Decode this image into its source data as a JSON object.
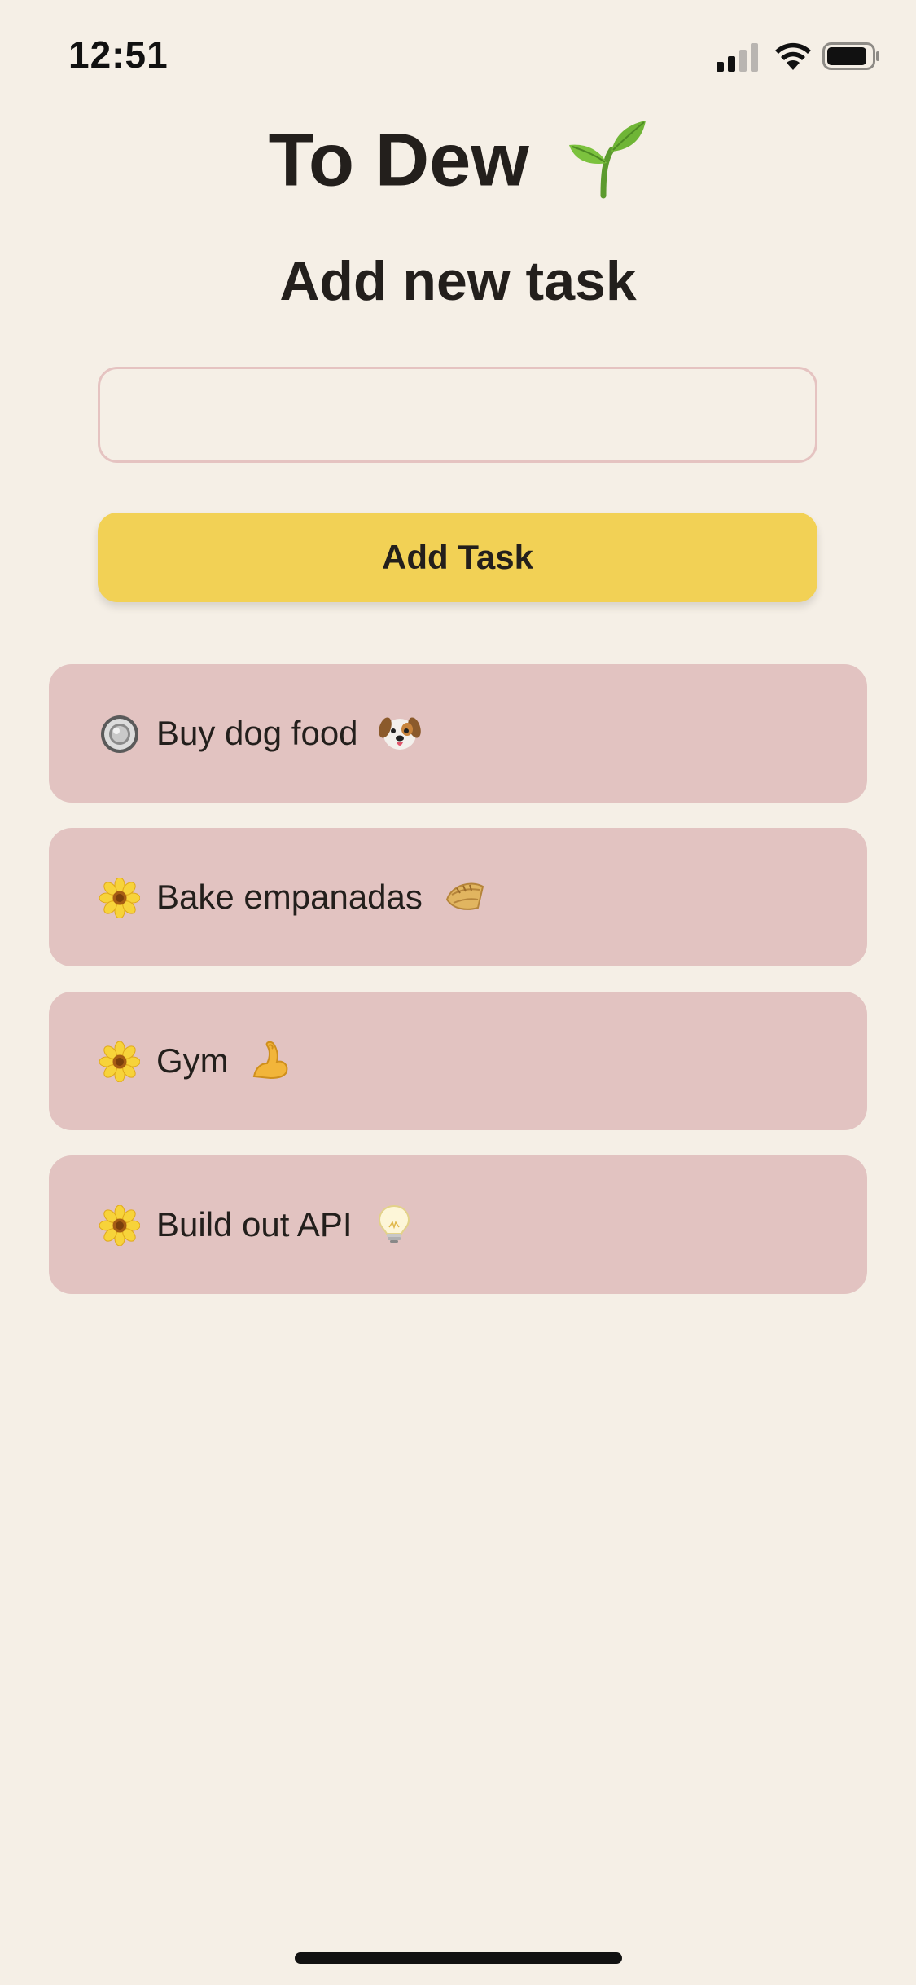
{
  "status_bar": {
    "time": "12:51",
    "icons": [
      "cellular-signal-icon",
      "wifi-icon",
      "battery-icon"
    ]
  },
  "header": {
    "title": "To Dew",
    "title_icon": "seedling-icon"
  },
  "form": {
    "heading": "Add new task",
    "input_value": "",
    "input_placeholder": "",
    "button_label": "Add Task"
  },
  "tasks": [
    {
      "label": "Buy dog food",
      "status_icon": "radio-button-icon",
      "emoji": "dog-face-icon"
    },
    {
      "label": "Bake empanadas",
      "status_icon": "blossom-icon",
      "emoji": "empanada-icon"
    },
    {
      "label": "Gym",
      "status_icon": "blossom-icon",
      "emoji": "flexed-biceps-icon"
    },
    {
      "label": "Build out API",
      "status_icon": "blossom-icon",
      "emoji": "light-bulb-icon"
    }
  ],
  "colors": {
    "background": "#f5efe6",
    "accent_button": "#f2d155",
    "task_card": "#e2c3c1",
    "input_border": "#e5c3c1",
    "text": "#231f1c"
  }
}
